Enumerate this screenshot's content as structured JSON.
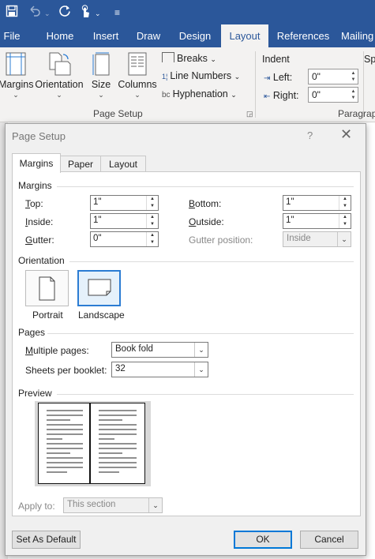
{
  "qat": {
    "save_icon": "save-icon",
    "undo_icon": "undo-icon",
    "redo_icon": "redo-icon",
    "touch_mode_icon": "touch-mode-icon",
    "customize_icon": "customize-qat-icon"
  },
  "tabs": [
    "File",
    "Home",
    "Insert",
    "Draw",
    "Design",
    "Layout",
    "References",
    "Mailing"
  ],
  "active_tab": "Layout",
  "ribbon": {
    "margins": "Margins",
    "orientation": "Orientation",
    "size": "Size",
    "columns": "Columns",
    "breaks": "Breaks",
    "line_numbers": "Line Numbers",
    "hyphenation": "Hyphenation",
    "page_setup_group": "Page Setup",
    "indent": "Indent",
    "spacing_partial": "Sp",
    "left_label": "Left:",
    "left_value": "0\"",
    "right_label": "Right:",
    "right_value": "0\"",
    "paragraph_group_partial": "Paragrap"
  },
  "dialog": {
    "title": "Page Setup",
    "help": "?",
    "close": "✕",
    "tabs": [
      "Margins",
      "Paper",
      "Layout"
    ],
    "active_tab": "Margins",
    "margins_section": "Margins",
    "top_label": "Top:",
    "top_value": "1\"",
    "bottom_label": "Bottom:",
    "bottom_value": "1\"",
    "inside_label": "Inside:",
    "inside_value": "1\"",
    "outside_label": "Outside:",
    "outside_value": "1\"",
    "gutter_label": "Gutter:",
    "gutter_value": "0\"",
    "gutter_position_label": "Gutter position:",
    "gutter_position_value": "Inside",
    "orientation_section": "Orientation",
    "portrait_label": "Portrait",
    "landscape_label": "Landscape",
    "selected_orientation": "Landscape",
    "pages_section": "Pages",
    "multiple_pages_label": "Multiple pages:",
    "multiple_pages_value": "Book fold",
    "sheets_per_booklet_label": "Sheets per booklet:",
    "sheets_per_booklet_value": "32",
    "preview_section": "Preview",
    "apply_to_label": "Apply to:",
    "apply_to_value": "This section",
    "set_as_default": "Set As Default",
    "ok": "OK",
    "cancel": "Cancel"
  },
  "colors": {
    "ribbon_blue": "#2b579a",
    "selection_blue": "#2b7cd3",
    "dialog_bg": "#f0f0f0"
  }
}
